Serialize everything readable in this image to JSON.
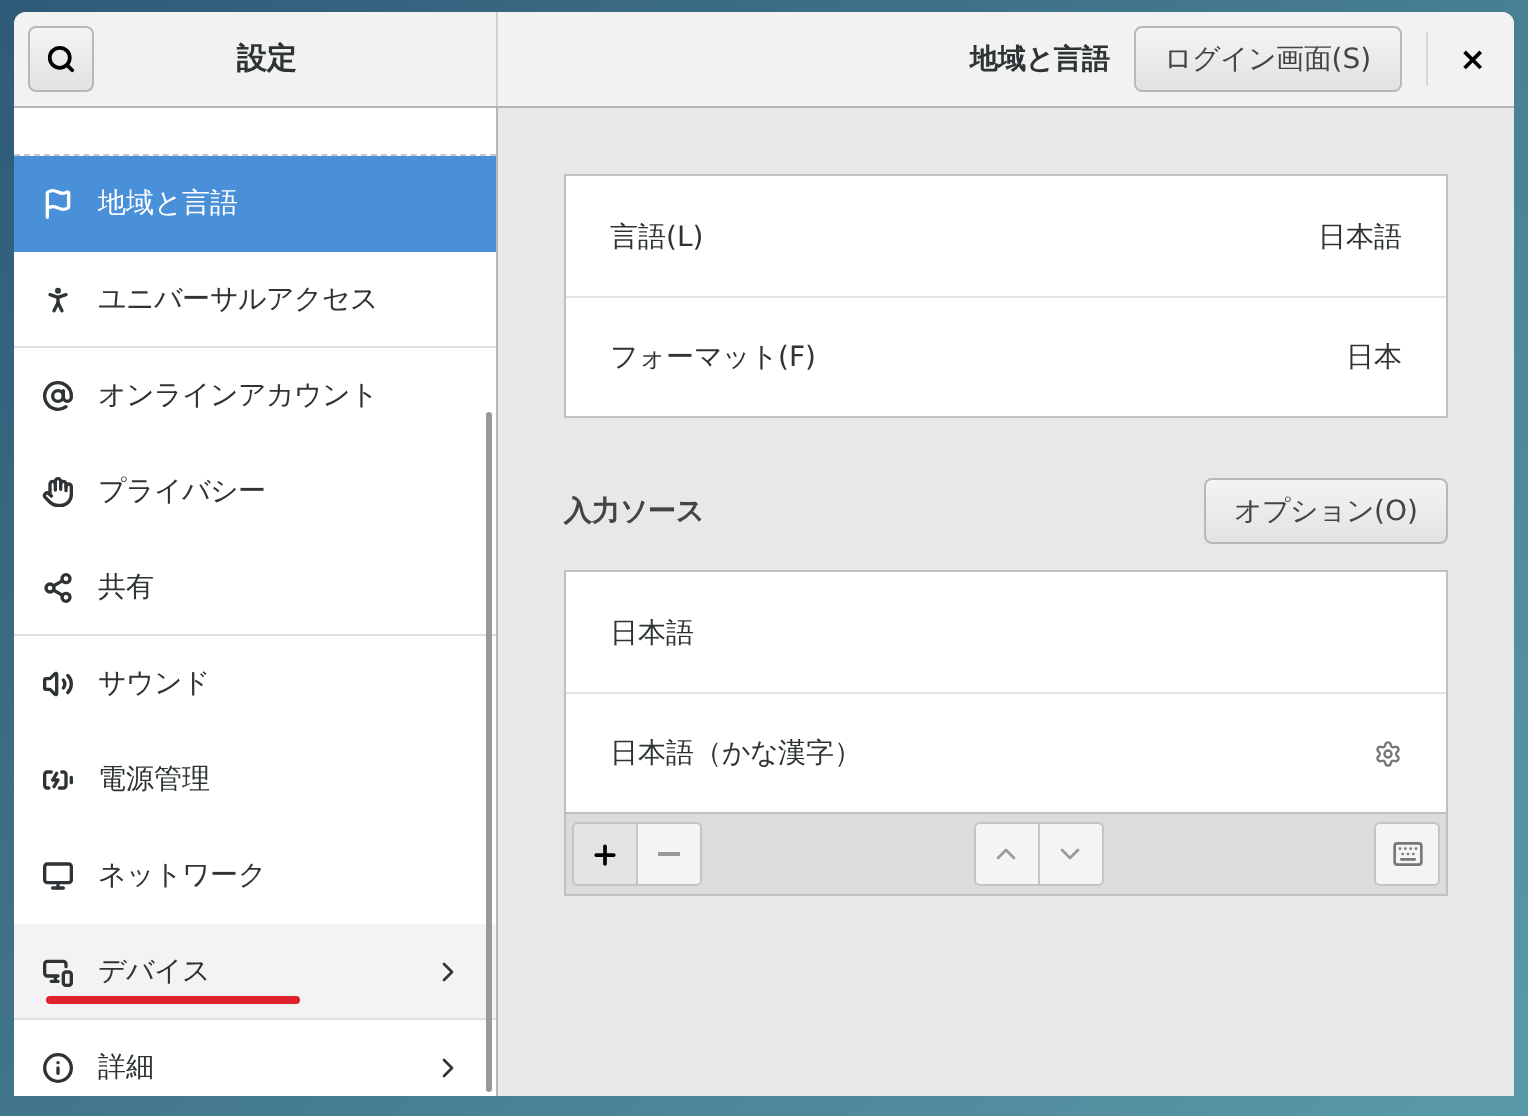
{
  "window": {
    "title": "設定",
    "page_title": "地域と言語",
    "login_button": "ログイン画面(S)",
    "close": "×"
  },
  "sidebar": {
    "items": [
      {
        "label": "地域と言語",
        "selected": true,
        "hovered": false,
        "submenu": false,
        "separator_after": false,
        "underlined": false
      },
      {
        "label": "ユニバーサルアクセス",
        "selected": false,
        "hovered": false,
        "submenu": false,
        "separator_after": true,
        "underlined": false
      },
      {
        "label": "オンラインアカウント",
        "selected": false,
        "hovered": false,
        "submenu": false,
        "separator_after": false,
        "underlined": false
      },
      {
        "label": "プライバシー",
        "selected": false,
        "hovered": false,
        "submenu": false,
        "separator_after": false,
        "underlined": false
      },
      {
        "label": "共有",
        "selected": false,
        "hovered": false,
        "submenu": false,
        "separator_after": true,
        "underlined": false
      },
      {
        "label": "サウンド",
        "selected": false,
        "hovered": false,
        "submenu": false,
        "separator_after": false,
        "underlined": false
      },
      {
        "label": "電源管理",
        "selected": false,
        "hovered": false,
        "submenu": false,
        "separator_after": false,
        "underlined": false
      },
      {
        "label": "ネットワーク",
        "selected": false,
        "hovered": false,
        "submenu": false,
        "separator_after": false,
        "underlined": false
      },
      {
        "label": "デバイス",
        "selected": false,
        "hovered": true,
        "submenu": true,
        "separator_after": true,
        "underlined": true
      },
      {
        "label": "詳細",
        "selected": false,
        "hovered": false,
        "submenu": true,
        "separator_after": false,
        "underlined": false
      }
    ]
  },
  "settings": [
    {
      "label": "言語(L)",
      "value": "日本語"
    },
    {
      "label": "フォーマット(F)",
      "value": "日本"
    }
  ],
  "input_sources": {
    "title": "入力ソース",
    "options_button": "オプション(O)",
    "items": [
      {
        "label": "日本語",
        "has_settings": false
      },
      {
        "label": "日本語（かな漢字）",
        "has_settings": true
      }
    ]
  }
}
